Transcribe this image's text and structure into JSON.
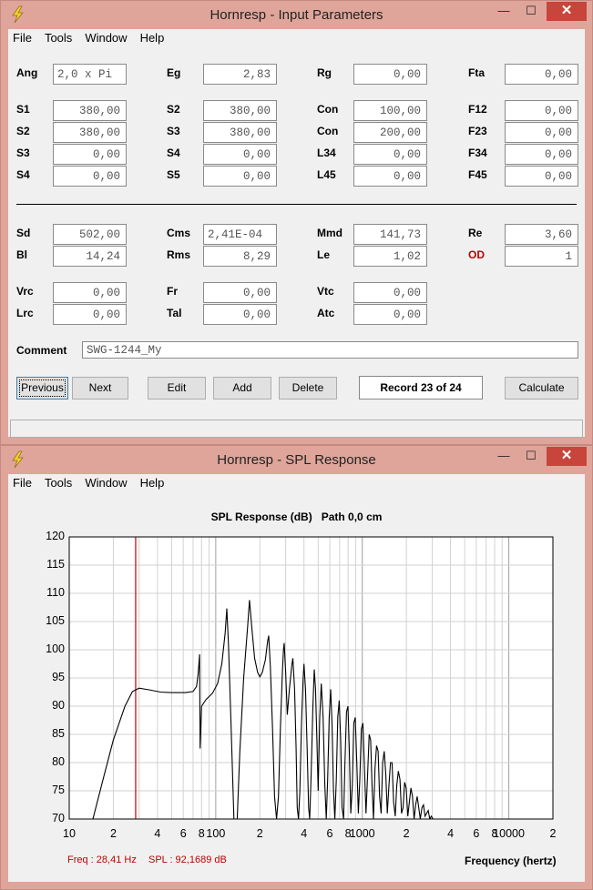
{
  "input_window": {
    "title": "Hornresp - Input Parameters",
    "menu": [
      "File",
      "Tools",
      "Window",
      "Help"
    ],
    "controls": {
      "minimize": "—",
      "maximize": "☐",
      "close": "✕"
    },
    "row1": {
      "ang_label": "Ang",
      "ang_value": "2,0 x Pi",
      "eg_label": "Eg",
      "eg_value": "2,83",
      "rg_label": "Rg",
      "rg_value": "0,00",
      "fta_label": "Fta",
      "fta_value": "0,00"
    },
    "col1": [
      {
        "label": "S1",
        "value": "380,00"
      },
      {
        "label": "S2",
        "value": "380,00"
      },
      {
        "label": "S3",
        "value": "0,00"
      },
      {
        "label": "S4",
        "value": "0,00"
      }
    ],
    "col2": [
      {
        "label": "S2",
        "value": "380,00"
      },
      {
        "label": "S3",
        "value": "380,00"
      },
      {
        "label": "S4",
        "value": "0,00"
      },
      {
        "label": "S5",
        "value": "0,00"
      }
    ],
    "col3": [
      {
        "label": "Con",
        "value": "100,00"
      },
      {
        "label": "Con",
        "value": "200,00"
      },
      {
        "label": "L34",
        "value": "0,00"
      },
      {
        "label": "L45",
        "value": "0,00"
      }
    ],
    "col4": [
      {
        "label": "F12",
        "value": "0,00"
      },
      {
        "label": "F23",
        "value": "0,00"
      },
      {
        "label": "F34",
        "value": "0,00"
      },
      {
        "label": "F45",
        "value": "0,00"
      }
    ],
    "driver": {
      "sd_label": "Sd",
      "sd_value": "502,00",
      "cms_label": "Cms",
      "cms_value": "2,41E-04",
      "mmd_label": "Mmd",
      "mmd_value": "141,73",
      "re_label": "Re",
      "re_value": "3,60",
      "bl_label": "Bl",
      "bl_value": "14,24",
      "rms_label": "Rms",
      "rms_value": "8,29",
      "le_label": "Le",
      "le_value": "1,02",
      "od_label": "OD",
      "od_value": "1"
    },
    "chambers": {
      "vrc_label": "Vrc",
      "vrc_value": "0,00",
      "fr_label": "Fr",
      "fr_value": "0,00",
      "vtc_label": "Vtc",
      "vtc_value": "0,00",
      "lrc_label": "Lrc",
      "lrc_value": "0,00",
      "tal_label": "Tal",
      "tal_value": "0,00",
      "atc_label": "Atc",
      "atc_value": "0,00"
    },
    "comment_label": "Comment",
    "comment_value": "SWG-1244_My",
    "buttons": {
      "previous": "Previous",
      "next": "Next",
      "edit": "Edit",
      "add": "Add",
      "delete": "Delete",
      "calculate": "Calculate"
    },
    "record": "Record 23 of 24"
  },
  "spl_window": {
    "title": "Hornresp - SPL Response",
    "menu": [
      "File",
      "Tools",
      "Window",
      "Help"
    ],
    "controls": {
      "minimize": "—",
      "maximize": "☐",
      "close": "✕"
    },
    "readout_freq": "Freq : 28,41 Hz",
    "readout_spl": "SPL : 92,1689 dB",
    "x_axis_title": "Frequency (hertz)"
  },
  "chart_data": {
    "type": "line",
    "title": "SPL Response (dB)   Path 0,0 cm",
    "xlabel": "Frequency (hertz)",
    "ylabel": "",
    "x_scale": "log",
    "xlim": [
      10,
      20000
    ],
    "ylim": [
      70,
      120
    ],
    "yticks": [
      "120",
      "115",
      "110",
      "105",
      "100",
      "95",
      "90",
      "85",
      "80",
      "75",
      "70"
    ],
    "xticks": [
      "10",
      "2",
      "4",
      "6",
      "8",
      "100",
      "2",
      "4",
      "6",
      "8",
      "1000",
      "2",
      "4",
      "6",
      "8",
      "10000",
      "2"
    ],
    "grid": true,
    "cursor_x": 28.41,
    "line_color": "#000000",
    "cursor_color": "#c00000",
    "series": [
      {
        "values": [
          [
            14.5,
            70
          ],
          [
            17,
            77
          ],
          [
            20,
            84
          ],
          [
            24,
            90
          ],
          [
            27,
            92.6
          ],
          [
            30,
            93.2
          ],
          [
            35,
            92.9
          ],
          [
            42,
            92.5
          ],
          [
            50,
            92.4
          ],
          [
            62,
            92.4
          ],
          [
            70,
            92.6
          ],
          [
            74,
            93.5
          ],
          [
            76,
            96
          ],
          [
            77.5,
            99.2
          ],
          [
            78.2,
            82.5
          ],
          [
            80,
            90
          ],
          [
            86,
            91.2
          ],
          [
            95,
            92.3
          ],
          [
            103,
            94
          ],
          [
            110,
            97.5
          ],
          [
            116,
            103
          ],
          [
            119,
            107.3
          ],
          [
            122,
            101
          ],
          [
            127,
            87
          ],
          [
            133,
            70
          ],
          [
            140,
            70
          ],
          [
            146,
            82
          ],
          [
            155,
            95
          ],
          [
            165,
            104
          ],
          [
            170,
            108.8
          ],
          [
            176,
            104
          ],
          [
            184,
            98.5
          ],
          [
            193,
            96
          ],
          [
            200,
            95.2
          ],
          [
            208,
            96
          ],
          [
            218,
            98.2
          ],
          [
            226,
            101.5
          ],
          [
            230,
            102.5
          ],
          [
            236,
            97
          ],
          [
            244,
            86
          ],
          [
            252,
            74
          ],
          [
            260,
            70
          ],
          [
            268,
            74
          ],
          [
            276,
            86
          ],
          [
            285,
            96
          ],
          [
            290,
            100
          ],
          [
            293,
            101.2
          ],
          [
            300,
            96
          ],
          [
            308,
            88.5
          ],
          [
            318,
            93
          ],
          [
            330,
            97.2
          ],
          [
            336,
            98.5
          ],
          [
            345,
            93
          ],
          [
            353,
            83
          ],
          [
            360,
            72
          ],
          [
            367,
            70
          ],
          [
            375,
            75
          ],
          [
            385,
            87
          ],
          [
            395,
            95
          ],
          [
            400,
            97.5
          ],
          [
            410,
            93
          ],
          [
            420,
            83
          ],
          [
            430,
            72
          ],
          [
            438,
            70
          ],
          [
            448,
            78
          ],
          [
            460,
            90
          ],
          [
            470,
            96.5
          ],
          [
            480,
            93
          ],
          [
            490,
            84
          ],
          [
            500,
            75
          ],
          [
            512,
            88
          ],
          [
            525,
            94
          ],
          [
            540,
            88
          ],
          [
            555,
            76
          ],
          [
            568,
            70
          ],
          [
            580,
            77
          ],
          [
            595,
            88
          ],
          [
            608,
            93
          ],
          [
            622,
            87
          ],
          [
            636,
            75
          ],
          [
            650,
            70
          ],
          [
            665,
            77
          ],
          [
            680,
            88
          ],
          [
            696,
            91
          ],
          [
            712,
            84
          ],
          [
            728,
            72
          ],
          [
            745,
            70
          ],
          [
            762,
            80
          ],
          [
            780,
            89
          ],
          [
            798,
            90
          ],
          [
            816,
            82
          ],
          [
            835,
            71
          ],
          [
            855,
            76
          ],
          [
            875,
            87
          ],
          [
            896,
            88
          ],
          [
            917,
            80
          ],
          [
            940,
            71
          ],
          [
            962,
            77
          ],
          [
            985,
            86
          ],
          [
            1010,
            87
          ],
          [
            1035,
            79
          ],
          [
            1060,
            71
          ],
          [
            1088,
            78
          ],
          [
            1115,
            85
          ],
          [
            1140,
            84
          ],
          [
            1165,
            76
          ],
          [
            1192,
            70
          ],
          [
            1222,
            79
          ],
          [
            1252,
            83
          ],
          [
            1282,
            82
          ],
          [
            1312,
            74
          ],
          [
            1345,
            71
          ],
          [
            1378,
            80
          ],
          [
            1412,
            82
          ],
          [
            1447,
            78
          ],
          [
            1483,
            71
          ],
          [
            1520,
            76
          ],
          [
            1558,
            80
          ],
          [
            1597,
            80
          ],
          [
            1637,
            73
          ],
          [
            1678,
            70.5
          ],
          [
            1720,
            76
          ],
          [
            1763,
            78.5
          ],
          [
            1807,
            77
          ],
          [
            1852,
            71
          ],
          [
            1898,
            72
          ],
          [
            1945,
            76.5
          ],
          [
            1994,
            75.5
          ],
          [
            2044,
            70.5
          ],
          [
            2095,
            73
          ],
          [
            2147,
            75.5
          ],
          [
            2201,
            74
          ],
          [
            2256,
            70
          ],
          [
            2312,
            72.5
          ],
          [
            2370,
            74
          ],
          [
            2430,
            72
          ],
          [
            2490,
            70
          ],
          [
            2552,
            72
          ],
          [
            2616,
            72.5
          ],
          [
            2681,
            70.5
          ],
          [
            2748,
            71
          ],
          [
            2817,
            71.5
          ],
          [
            2887,
            70
          ],
          [
            2960,
            70.5
          ],
          [
            3035,
            70
          ]
        ]
      }
    ]
  }
}
